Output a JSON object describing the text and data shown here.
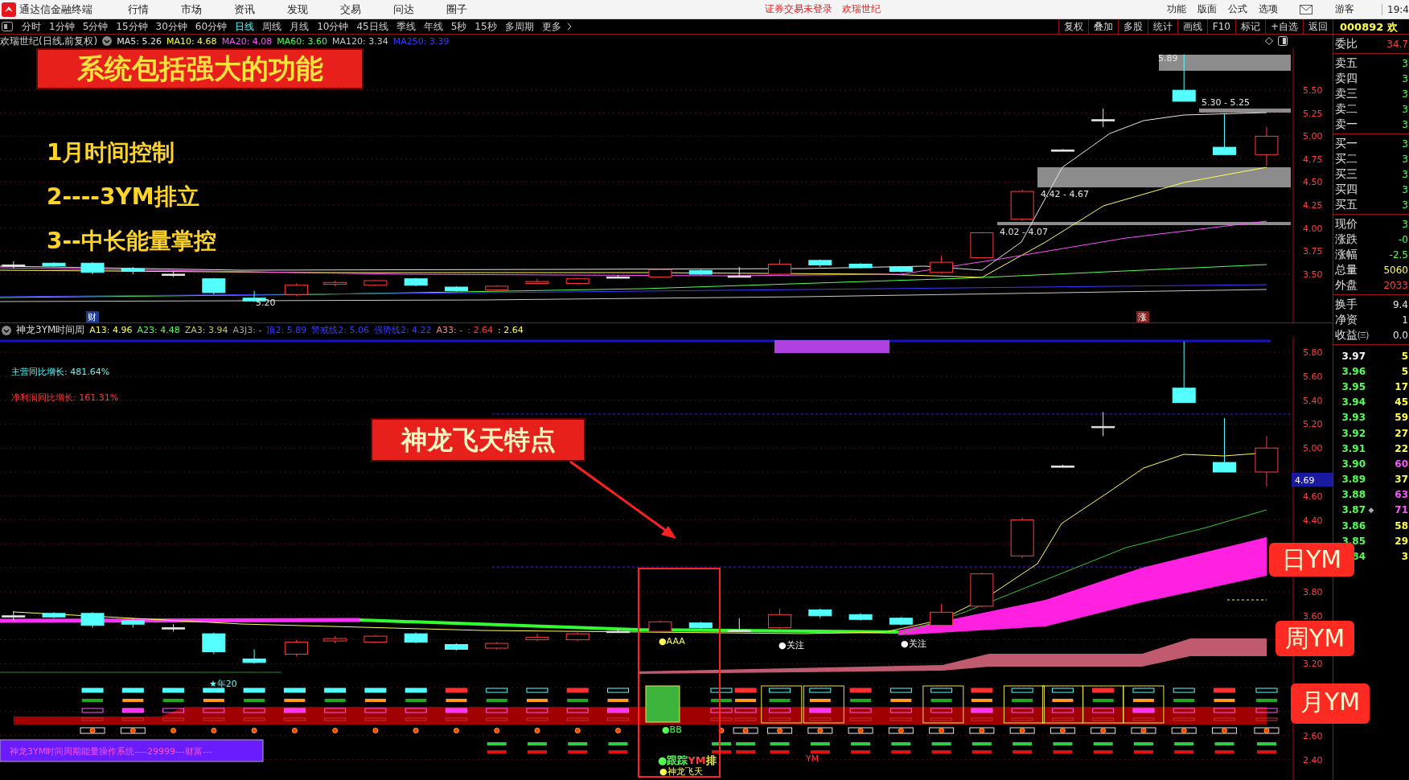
{
  "menu_bar": {
    "app_title": "通达信金融终端",
    "items": [
      "行情",
      "市场",
      "资讯",
      "发现",
      "交易",
      "问达",
      "圈子"
    ],
    "login_notice": "证券交易未登录",
    "stock_name": "欢瑞世纪",
    "right_items": [
      "功能",
      "版面",
      "公式",
      "选项"
    ],
    "user": "游客",
    "time": "19:4"
  },
  "period_tabs": [
    {
      "label": "分时",
      "selected": false
    },
    {
      "label": "1分钟",
      "selected": false
    },
    {
      "label": "5分钟",
      "selected": false
    },
    {
      "label": "15分钟",
      "selected": false
    },
    {
      "label": "30分钟",
      "selected": false
    },
    {
      "label": "60分钟",
      "selected": false
    },
    {
      "label": "日线",
      "selected": true
    },
    {
      "label": "周线",
      "selected": false
    },
    {
      "label": "月线",
      "selected": false
    },
    {
      "label": "10分钟",
      "selected": false
    },
    {
      "label": "45日线",
      "selected": false
    },
    {
      "label": "季线",
      "selected": false
    },
    {
      "label": "年线",
      "selected": false
    },
    {
      "label": "5秒",
      "selected": false
    },
    {
      "label": "15秒",
      "selected": false
    },
    {
      "label": "多周期",
      "selected": false
    },
    {
      "label": "更多",
      "selected": false
    }
  ],
  "tool_buttons": [
    "复权",
    "叠加",
    "多股",
    "统计",
    "画线",
    "F10",
    "标记",
    "+自选",
    "返回"
  ],
  "quote_code": "000892 欢",
  "main_chart": {
    "title": "欢瑞世纪(日线,前复权)",
    "moving_averages": [
      {
        "label": "MA5: 5.26",
        "color": "#e6e6e6"
      },
      {
        "label": "MA10: 4.68",
        "color": "#ffff54"
      },
      {
        "label": "MA20: 4.08",
        "color": "#ff54ff"
      },
      {
        "label": "MA60: 3.60",
        "color": "#54ff54"
      },
      {
        "label": "MA120: 3.34",
        "color": "#c8c8c8"
      },
      {
        "label": "MA250: 3.39",
        "color": "#3c3cff"
      }
    ],
    "y_axis": [
      "5.50",
      "5.25",
      "5.00",
      "4.75",
      "4.50",
      "4.25",
      "4.00",
      "3.75",
      "3.50"
    ],
    "zones": [
      "5.89",
      "5.30 - 5.25",
      "4.42 - 4.67",
      "4.02 - 4.07"
    ],
    "low_marker": "5.20",
    "badges": [
      {
        "text": "财",
        "color": "#1e3c8c"
      },
      {
        "text": "涨",
        "color": "#8c1e1e"
      }
    ]
  },
  "indicator": {
    "title": "神龙3YM时间周",
    "values": [
      {
        "label": "A13:",
        "value": "4.96",
        "color": "#ffff54"
      },
      {
        "label": "A23:",
        "value": "4.48",
        "color": "#54ff54"
      },
      {
        "label": "ZA3:",
        "value": "3.94",
        "color": "#c8c850"
      },
      {
        "label": "A3J3:",
        "value": "-",
        "color": "#a0a0a0"
      },
      {
        "label": "顶2:",
        "value": "5.89",
        "color": "#3c3cff"
      },
      {
        "label": "警戒线2:",
        "value": "5.06",
        "color": "#3c3cff"
      },
      {
        "label": "强势线2:",
        "value": "4.22",
        "color": "#3c3cff"
      },
      {
        "label": "A33:",
        "value": "-",
        "color": "#ff8080"
      },
      {
        "label": ":",
        "value": "2.64",
        "color": "#ff3c3c"
      },
      {
        "label": ":",
        "value": "2.64",
        "color": "#ffff54"
      }
    ],
    "growth": [
      {
        "text": "主营同比增长: 481.64%",
        "color": "#54ffff"
      },
      {
        "text": "净利润同比增长: 161.31%",
        "color": "#ff3c3c"
      }
    ],
    "y_axis": [
      "5.80",
      "5.60",
      "5.40",
      "5.20",
      "5.00",
      "4.60",
      "4.40",
      "3.80",
      "3.60",
      "3.20",
      "2.60",
      "2.40"
    ],
    "price_tag": "4.69",
    "signals": [
      {
        "text": "●AAA",
        "color": "#ffff54"
      },
      {
        "text": "●关注",
        "color": "#ffffff"
      },
      {
        "text": "●关注",
        "color": "#ffffff"
      },
      {
        "text": "★年20",
        "color": "#54ffff"
      },
      {
        "text": "●BB",
        "color": "#54ff54"
      },
      {
        "text": "YM",
        "color": "#ff3c3c"
      },
      {
        "text": "●神龙飞天",
        "color": "#ffff54"
      }
    ],
    "tracking": [
      {
        "text": "●跟踪",
        "color": "#54ff54"
      },
      {
        "text": "YM",
        "color": "#ff3c3c"
      },
      {
        "text": "排",
        "color": "#ffff54"
      }
    ],
    "banner": "神龙3YM时间周期能量操作系统----29999---财富---"
  },
  "callouts": {
    "headline": "系统包括强大的功能",
    "features": [
      "1月时间控制",
      "2----3YM排立",
      "3--中长能量掌控"
    ],
    "feature_label": "神龙飞天特点",
    "levels": [
      "日YM",
      "周YM",
      "月YM"
    ]
  },
  "order_book": {
    "sections": [
      {
        "rows": [
          {
            "label": "委比",
            "value": "34.7",
            "color": "#ff4040"
          }
        ]
      },
      {
        "rows": [
          {
            "label": "卖五",
            "value": "3",
            "color": "#54ff54"
          },
          {
            "label": "卖四",
            "value": "3",
            "color": "#54ff54"
          },
          {
            "label": "卖三",
            "value": "3",
            "color": "#54ff54"
          },
          {
            "label": "卖二",
            "value": "3",
            "color": "#54ff54"
          },
          {
            "label": "卖一",
            "value": "3",
            "color": "#54ff54"
          }
        ]
      },
      {
        "rows": [
          {
            "label": "买一",
            "value": "3",
            "color": "#54ff54"
          },
          {
            "label": "买二",
            "value": "3",
            "color": "#54ff54"
          },
          {
            "label": "买三",
            "value": "3",
            "color": "#54ff54"
          },
          {
            "label": "买四",
            "value": "3",
            "color": "#54ff54"
          },
          {
            "label": "买五",
            "value": "3",
            "color": "#54ff54"
          }
        ]
      },
      {
        "rows": [
          {
            "label": "现价",
            "value": "3",
            "color": "#54ff54"
          },
          {
            "label": "涨跌",
            "value": "-0",
            "color": "#54ff54"
          },
          {
            "label": "涨幅",
            "value": "-2.5",
            "color": "#54ff54"
          },
          {
            "label": "总量",
            "value": "5060",
            "color": "#ffff54"
          },
          {
            "label": "外盘",
            "value": "2033",
            "color": "#ff4040"
          }
        ]
      },
      {
        "rows": [
          {
            "label": "换手",
            "value": "9.4",
            "color": "#e6e6e6"
          },
          {
            "label": "净资",
            "value": "1",
            "color": "#e6e6e6"
          },
          {
            "label": "收益㈢",
            "value": "0.0",
            "color": "#e6e6e6"
          }
        ]
      }
    ],
    "ladder": [
      {
        "price": {
          "text": "3.97",
          "color": "#ffffff"
        },
        "volume": {
          "text": "5",
          "color": "#ffff54"
        }
      },
      {
        "price": {
          "text": "3.96",
          "color": "#54ff54"
        },
        "volume": {
          "text": "5",
          "color": "#ffff54"
        }
      },
      {
        "price": {
          "text": "3.95",
          "color": "#54ff54"
        },
        "volume": {
          "text": "17",
          "color": "#ffff54"
        }
      },
      {
        "price": {
          "text": "3.94",
          "color": "#54ff54"
        },
        "volume": {
          "text": "45",
          "color": "#ffff54"
        }
      },
      {
        "price": {
          "text": "3.93",
          "color": "#54ff54"
        },
        "volume": {
          "text": "59",
          "color": "#ffff54"
        }
      },
      {
        "price": {
          "text": "3.92",
          "color": "#54ff54"
        },
        "volume": {
          "text": "27",
          "color": "#ffff54"
        }
      },
      {
        "price": {
          "text": "3.91",
          "color": "#54ff54"
        },
        "volume": {
          "text": "22",
          "color": "#ffff54"
        }
      },
      {
        "price": {
          "text": "3.90",
          "color": "#54ff54"
        },
        "volume": {
          "text": "60",
          "color": "#ff54ff"
        }
      },
      {
        "price": {
          "text": "3.89",
          "color": "#54ff54"
        },
        "volume": {
          "text": "37",
          "color": "#ffff54"
        }
      },
      {
        "price": {
          "text": "3.88",
          "color": "#54ff54"
        },
        "volume": {
          "text": "63",
          "color": "#ff54ff"
        }
      },
      {
        "price": {
          "text": "3.87",
          "color": "#54ff54"
        },
        "marker": "◆",
        "volume": {
          "text": "71",
          "color": "#ff54ff"
        }
      },
      {
        "price": {
          "text": "3.86",
          "color": "#54ff54"
        },
        "volume": {
          "text": "58",
          "color": "#ffff54"
        }
      },
      {
        "price": {
          "text": "3.85",
          "color": "#54ff54"
        },
        "volume": {
          "text": "29",
          "color": "#ffff54"
        }
      },
      {
        "price": {
          "text": "84",
          "color": "#54ff54"
        },
        "volume": {
          "text": "3",
          "color": "#ffff54"
        }
      }
    ]
  }
}
